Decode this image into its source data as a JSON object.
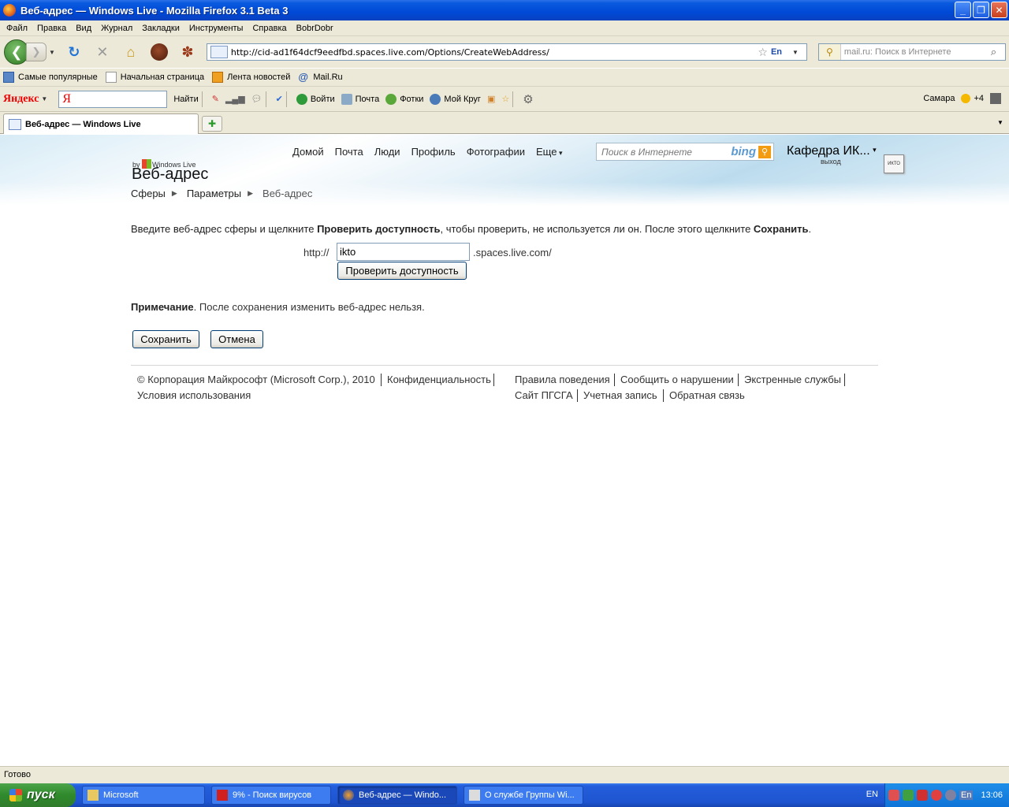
{
  "window": {
    "title": "Веб-адрес — Windows Live - Mozilla Firefox 3.1 Beta 3"
  },
  "menu": [
    "Файл",
    "Правка",
    "Вид",
    "Журнал",
    "Закладки",
    "Инструменты",
    "Справка",
    "BobrDobr"
  ],
  "address_bar": {
    "url": "http://cid-ad1f64dcf9eedfbd.spaces.live.com/Options/CreateWebAddress/",
    "lang": "En"
  },
  "search_bar": {
    "placeholder": "mail.ru: Поиск в Интернете"
  },
  "bookmarks": [
    "Самые популярные",
    "Начальная страница",
    "Лента новостей",
    "Mail.Ru"
  ],
  "yandex": {
    "logo": "Яндекс",
    "input_letter": "Я",
    "find": "Найти",
    "items": [
      "Войти",
      "Почта",
      "Фотки",
      "Мой Круг"
    ],
    "weather_city": "Самара",
    "weather_temp": "+4"
  },
  "tabs": [
    {
      "label": "Веб-адрес — Windows Live"
    }
  ],
  "page": {
    "nav": [
      "Домой",
      "Почта",
      "Люди",
      "Профиль",
      "Фотографии",
      "Еще"
    ],
    "web_search_placeholder": "Поиск в Интернете",
    "bing": "bing",
    "user_name": "Кафедра ИК...",
    "logout": "выход",
    "avatar_text": "ИКТО",
    "brand_by": "by",
    "brand_windows_live": "Windows Live",
    "brand_title": "Веб-адрес",
    "breadcrumbs": [
      "Сферы",
      "Параметры",
      "Веб-адрес"
    ],
    "instructions": {
      "pre": "Введите веб-адрес сферы и щелкните ",
      "bold1": "Проверить доступность",
      "mid": ", чтобы проверить, не используется ли он. После этого щелкните ",
      "bold2": "Сохранить",
      "post": "."
    },
    "http_label": "http://",
    "address_value": "ikto",
    "domain_suffix": ".spaces.live.com/",
    "check_button": "Проверить доступность",
    "note_label": "Примечание",
    "note_text": ". После сохранения изменить веб-адрес нельзя.",
    "save_button": "Сохранить",
    "cancel_button": "Отмена",
    "footer": {
      "copyright": "© Корпорация Майкрософт (Microsoft Corp.), 2010",
      "privacy": "Конфиденциальность",
      "terms": "Условия использования",
      "conduct": "Правила поведения",
      "report": "Сообщить о нарушении",
      "emergency": "Экстренные службы",
      "site": "Сайт ПГСГА",
      "account": "Учетная запись",
      "feedback": "Обратная связь"
    }
  },
  "status": "Готово",
  "taskbar": {
    "start": "пуск",
    "tasks": [
      "Microsoft",
      "9% - Поиск вирусов",
      "Веб-адрес — Windo...",
      "О службе Группы Wi..."
    ],
    "lang": "EN",
    "tray_lang": "En",
    "clock": "13:06"
  }
}
